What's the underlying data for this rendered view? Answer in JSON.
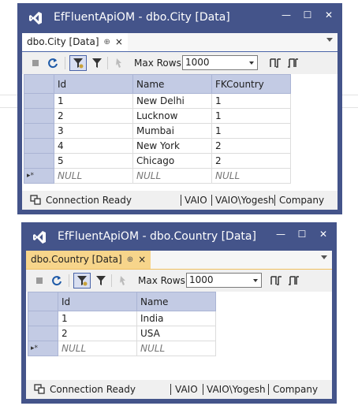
{
  "windows": [
    {
      "title": "EfFluentApiOM - dbo.City [Data]",
      "tab": {
        "label": "dbo.City [Data]",
        "pin": "⊕",
        "close": "×",
        "active": false
      },
      "toolbar": {
        "max_rows_label": "Max Rows:",
        "max_rows_value": "1000"
      },
      "grid": {
        "columns": [
          "Id",
          "Name",
          "FKCountry"
        ],
        "rows": [
          [
            "1",
            "New Delhi",
            "1"
          ],
          [
            "2",
            "Lucknow",
            "1"
          ],
          [
            "3",
            "Mumbai",
            "1"
          ],
          [
            "4",
            "New York",
            "2"
          ],
          [
            "5",
            "Chicago",
            "2"
          ]
        ],
        "new_row": [
          "NULL",
          "NULL",
          "NULL"
        ],
        "new_row_marker": "▸*"
      },
      "status": {
        "connection": "Connection Ready",
        "server": "VAIO",
        "user": "VAIO\\Yogesh",
        "database": "Company"
      }
    },
    {
      "title": "EfFluentApiOM - dbo.Country [Data]",
      "tab": {
        "label": "dbo.Country [Data]",
        "pin": "⊕",
        "close": "×",
        "active": true
      },
      "toolbar": {
        "max_rows_label": "Max Rows:",
        "max_rows_value": "1000"
      },
      "grid": {
        "columns": [
          "Id",
          "Name"
        ],
        "rows": [
          [
            "1",
            "India"
          ],
          [
            "2",
            "USA"
          ]
        ],
        "new_row": [
          "NULL",
          "NULL"
        ],
        "new_row_marker": "▸*"
      },
      "status": {
        "connection": "Connection Ready",
        "server": "VAIO",
        "user": "VAIO\\Yogesh",
        "database": "Company"
      }
    }
  ],
  "window_controls": {
    "minimize": "—",
    "maximize": "☐",
    "close": "✕"
  },
  "colors": {
    "titlebar": "#44548a",
    "header": "#c3cbe4",
    "active_tab": "#f7d58b",
    "accent": "#4a64a8"
  }
}
